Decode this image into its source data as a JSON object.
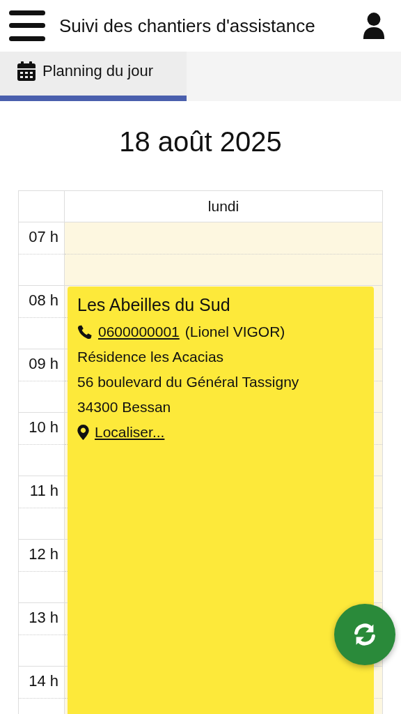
{
  "app_bar": {
    "title": "Suivi des chantiers d'assistance"
  },
  "tabs": [
    {
      "label": "Planning du jour",
      "selected": true
    }
  ],
  "date": "18 août 2025",
  "calendar": {
    "day": "lundi",
    "hours": [
      {
        "label": "07 h"
      },
      {
        "label": "08 h",
        "events": [
          {
            "title": "Les Abeilles du Sud",
            "phone": "0600000001",
            "contact": "(Lionel VIGOR)",
            "address_lines": [
              "Résidence les Acacias",
              "56 boulevard du Général Tassigny",
              "34300 Bessan"
            ],
            "locate_link": "Localiser..."
          }
        ]
      },
      {
        "label": "09 h"
      },
      {
        "label": "10 h"
      },
      {
        "label": "11 h"
      },
      {
        "label": "12 h"
      },
      {
        "label": "13 h"
      },
      {
        "label": "14 h"
      }
    ]
  }
}
